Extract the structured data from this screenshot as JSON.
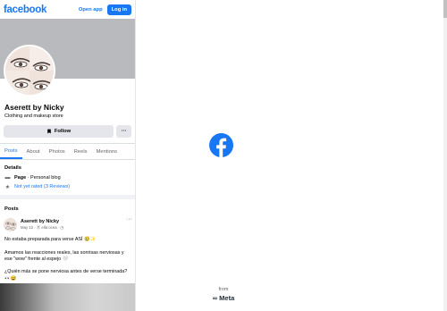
{
  "topbar": {
    "logo": "facebook",
    "open_app": "Open app",
    "login": "Log in"
  },
  "profile": {
    "name": "Aserett by Nicky",
    "category": "Clothing and makeup store",
    "follow": "Follow",
    "more": "···"
  },
  "tabs": [
    {
      "label": "Posts",
      "active": true
    },
    {
      "label": "About"
    },
    {
      "label": "Photos"
    },
    {
      "label": "Reels"
    },
    {
      "label": "Mentions"
    }
  ],
  "details": {
    "title": "Details",
    "page_label": "Page",
    "page_type": " · Personal blog",
    "rating": "Not yet rated (3 Reviews)"
  },
  "posts": {
    "title": "Posts",
    "author": "Aserett by Nicky",
    "meta": "May 12 · Ⓓ ella ocea · ◷",
    "dots": "···",
    "text": [
      "No estaba preparada para verse ASÍ 😢✨",
      "",
      "Amamos las reacciones reales, las sonrisas nerviosas y ese \"wow\" frente al espejo 🤍",
      "",
      "¿Quién más se pone nerviosa antes de verse terminada? 👀😅"
    ]
  },
  "splash": {
    "from": "from",
    "meta": "∞ Meta"
  },
  "colors": {
    "brand": "#1877f2",
    "cover": "#b8babd"
  }
}
